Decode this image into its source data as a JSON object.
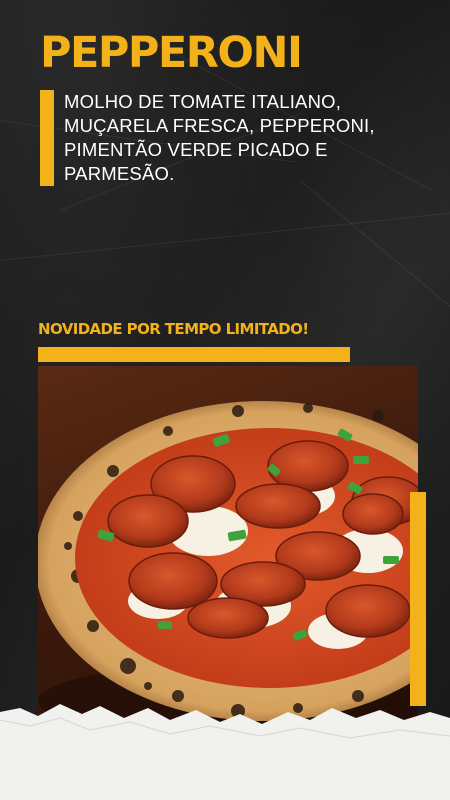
{
  "title": "PEPPERONI",
  "description": "MOLHO DE TOMATE ITALIANO, MUÇARELA FRESCA, PEPPERONI, PIMENTÃO VERDE PICADO E PARMESÃO.",
  "promo": "NOVIDADE POR TEMPO LIMITADO!",
  "colors": {
    "accent": "#f3b21a",
    "background": "#1d1d1d",
    "text": "#ffffff"
  }
}
